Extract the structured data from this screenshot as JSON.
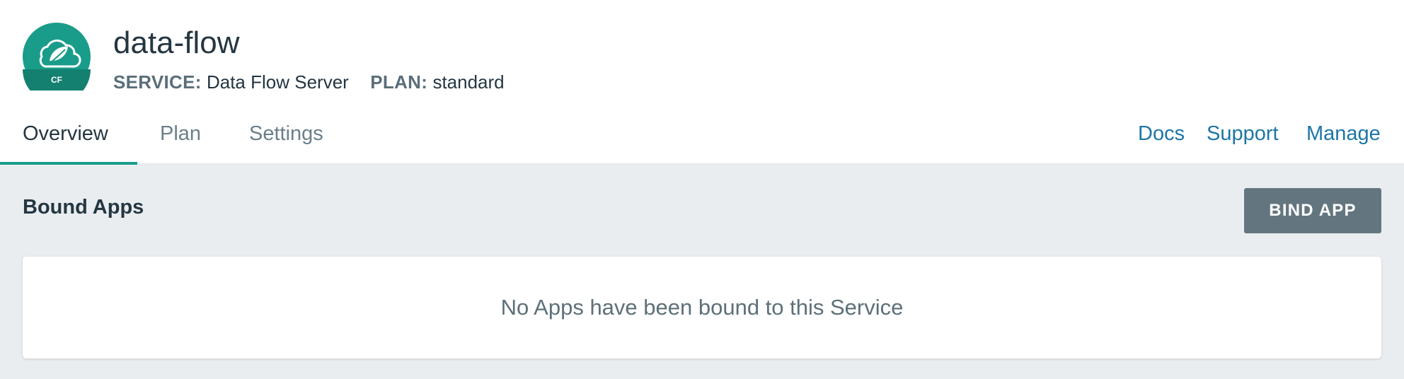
{
  "service": {
    "name": "data-flow",
    "service_key": "SERVICE:",
    "service_value": "Data Flow Server",
    "plan_key": "PLAN:",
    "plan_value": "standard",
    "logo_badge": "CF",
    "logo_icon": "spring-leaf-cloud-icon"
  },
  "tabs": [
    {
      "label": "Overview",
      "active": true
    },
    {
      "label": "Plan",
      "active": false
    },
    {
      "label": "Settings",
      "active": false
    }
  ],
  "links": [
    {
      "label": "Docs"
    },
    {
      "label": "Support"
    },
    {
      "label": "Manage"
    }
  ],
  "bound_apps": {
    "title": "Bound Apps",
    "bind_button": "BIND APP",
    "empty_message": "No Apps have been bound to this Service"
  },
  "colors": {
    "accent": "#1a9c8a",
    "link": "#1d76a5",
    "button": "#637680",
    "panel_bg": "#e9edf0"
  }
}
